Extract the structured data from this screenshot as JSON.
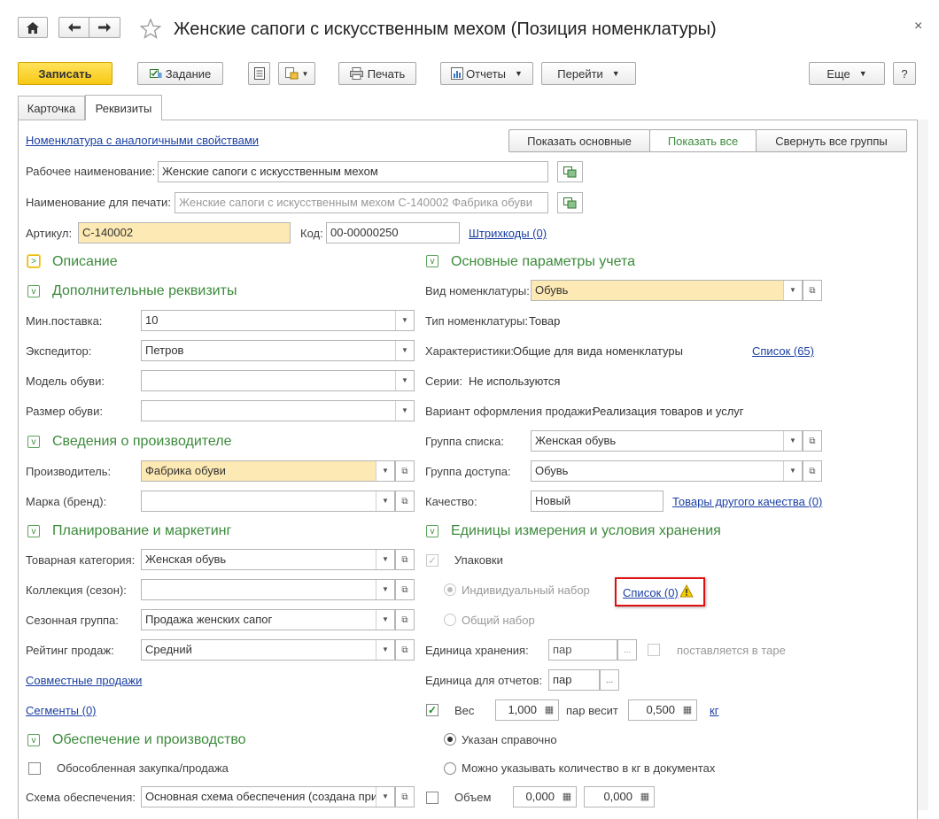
{
  "window": {
    "title": "Женские сапоги с искусственным мехом (Позиция номенклатуры)",
    "close_glyph": "×"
  },
  "toolbar": {
    "save": "Записать",
    "task": "Задание",
    "print": "Печать",
    "reports": "Отчеты",
    "goto": "Перейти",
    "more": "Еще",
    "help": "?"
  },
  "tabs": [
    {
      "label": "Карточка",
      "active": false
    },
    {
      "label": "Реквизиты",
      "active": true
    }
  ],
  "top": {
    "similar_link": "Номенклатура с аналогичными свойствами",
    "view_buttons": [
      "Показать основные",
      "Показать все",
      "Свернуть все группы"
    ]
  },
  "fields": {
    "work_name_label": "Рабочее наименование:",
    "work_name_value": "Женские сапоги с искусственным мехом",
    "print_name_label": "Наименование для печати:",
    "print_name_placeholder": "Женские сапоги с искусственным мехом С-140002 Фабрика обуви",
    "article_label": "Артикул:",
    "article_value": "С-140002",
    "code_label": "Код:",
    "code_value": "00-00000250",
    "barcodes_link": "Штрихкоды (0)"
  },
  "left": {
    "description_header": "Описание",
    "extra_header": "Дополнительные реквизиты",
    "min_supply_label": "Мин.поставка:",
    "min_supply_value": "10",
    "forwarder_label": "Экспедитор:",
    "forwarder_value": "Петров",
    "shoe_model_label": "Модель обуви:",
    "shoe_model_value": "",
    "shoe_size_label": "Размер обуви:",
    "shoe_size_value": "",
    "manufacturer_header": "Сведения о производителе",
    "manufacturer_label": "Производитель:",
    "manufacturer_value": "Фабрика обуви",
    "brand_label": "Марка (бренд):",
    "brand_value": "",
    "planning_header": "Планирование и маркетинг",
    "category_label": "Товарная категория:",
    "category_value": "Женская обувь",
    "collection_label": "Коллекция (сезон):",
    "collection_value": "",
    "season_group_label": "Сезонная группа:",
    "season_group_value": "Продажа женских сапог",
    "rating_label": "Рейтинг продаж:",
    "rating_value": "Средний",
    "joint_sales_link": "Совместные продажи",
    "segments_link": "Сегменты (0)",
    "supply_header": "Обеспечение и производство",
    "separate_purchase_label": "Обособленная закупка/продажа",
    "supply_scheme_label": "Схема обеспечения:",
    "supply_scheme_value": "Основная схема обеспечения (создана при"
  },
  "right": {
    "main_params_header": "Основные параметры учета",
    "kind_label": "Вид номенклатуры:",
    "kind_value": "Обувь",
    "type_label": "Тип номенклатуры:",
    "type_value": "Товар",
    "chars_label": "Характеристики:",
    "chars_value": "Общие для вида номенклатуры",
    "chars_link": "Список (65)",
    "series_label": "Серии:",
    "series_value": "Не используются",
    "sale_label": "Вариант оформления продажи:",
    "sale_value": "Реализация товаров и услуг",
    "list_group_label": "Группа списка:",
    "list_group_value": "Женская обувь",
    "access_group_label": "Группа доступа:",
    "access_group_value": "Обувь",
    "quality_label": "Качество:",
    "quality_value": "Новый",
    "other_quality_link": "Товары другого качества (0)",
    "units_header": "Единицы измерения и условия хранения",
    "packages_label": "Упаковки",
    "individual_set_label": "Индивидуальный набор",
    "packages_list_link": "Список (0)",
    "common_set_label": "Общий набор",
    "storage_unit_label": "Единица хранения:",
    "storage_unit_value": "пар",
    "in_tare_label": "поставляется в таре",
    "report_unit_label": "Единица для отчетов:",
    "report_unit_value": "пар",
    "weight_label": "Вес",
    "weight_value": "1,000",
    "pair_weighs_label": "пар весит",
    "pair_weighs_value": "0,500",
    "kg_link": "кг",
    "specified_label": "Указан справочно",
    "kg_in_docs_label": "Можно указывать количество в кг в документах",
    "volume_label": "Объем",
    "volume_value1": "0,000",
    "volume_value2": "0,000"
  },
  "colors": {
    "accent_green": "#3b8a3b",
    "link_blue": "#1a3fa3",
    "required_yellow": "#fde9b3",
    "highlight_red": "#e01010"
  }
}
